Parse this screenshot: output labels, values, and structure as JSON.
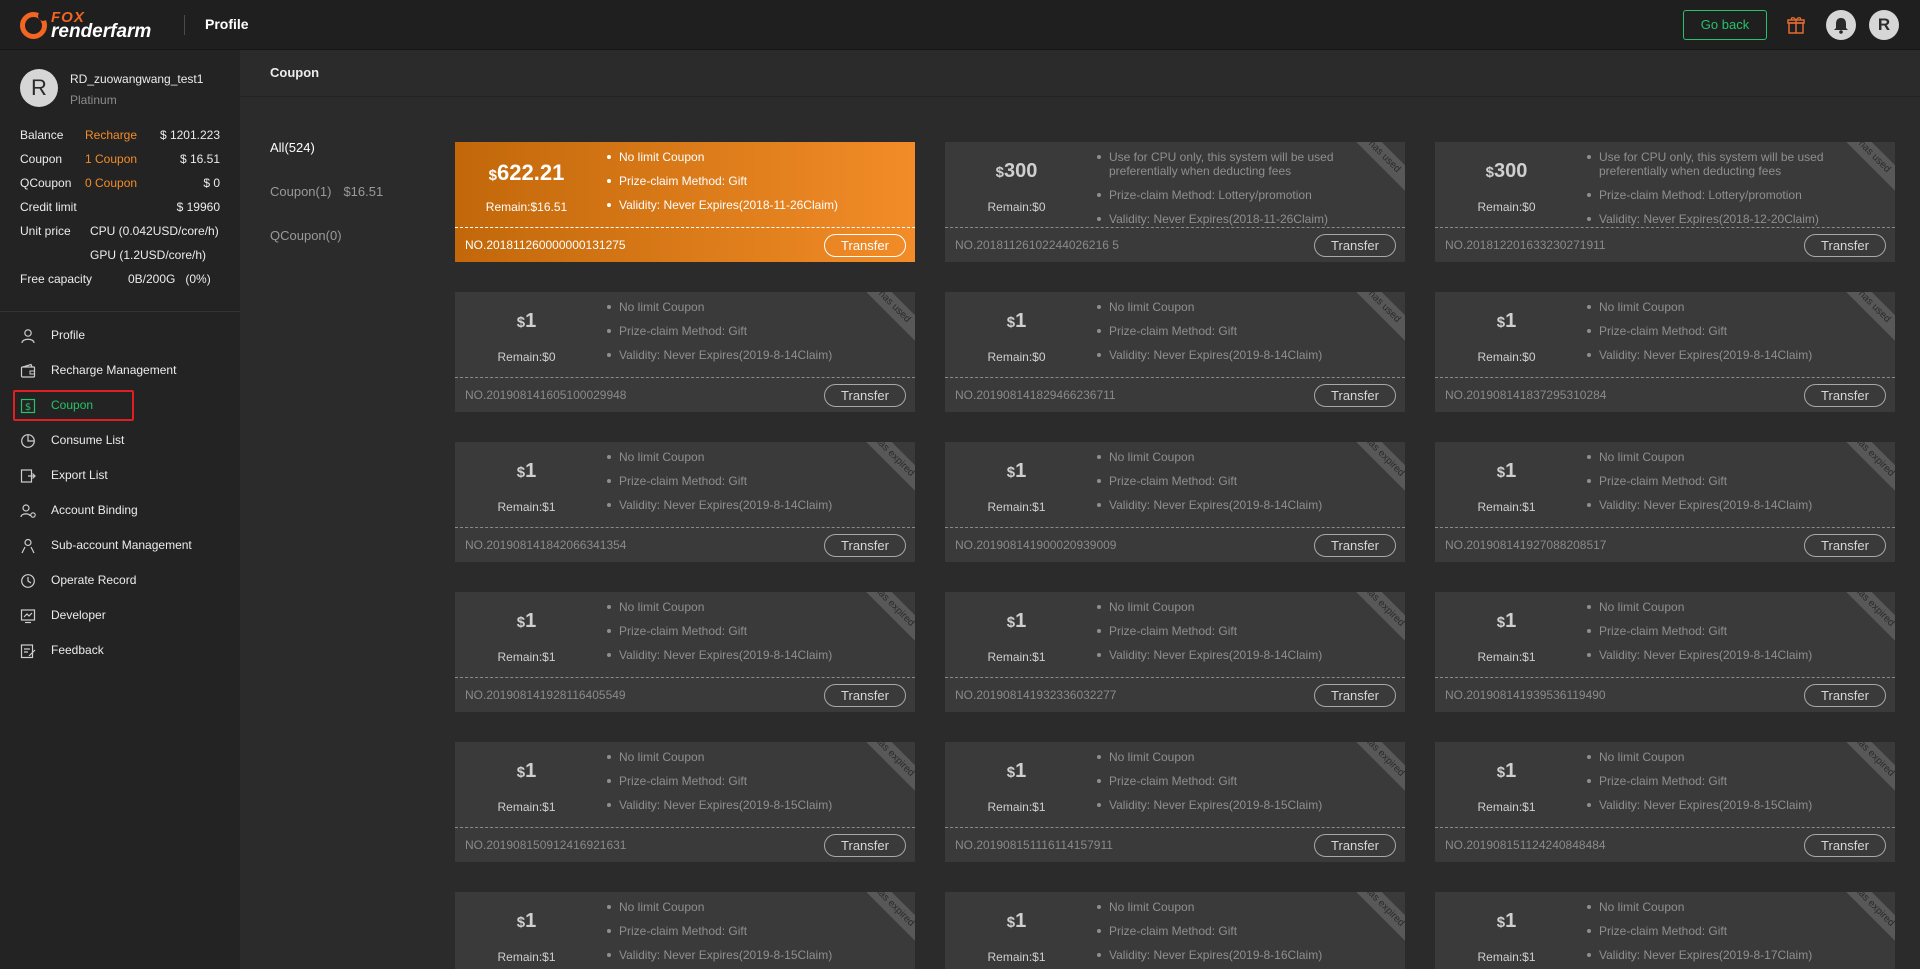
{
  "header": {
    "logo_fox": "FOX",
    "logo_rf": "renderfarm",
    "title": "Profile",
    "go_back": "Go back",
    "avatar_initial": "R"
  },
  "user": {
    "initial": "R",
    "name": "RD_zuowangwang_test1",
    "level": "Platinum"
  },
  "account": {
    "balance_label": "Balance",
    "recharge_link": "Recharge",
    "balance_value": "$ 1201.223",
    "coupon_label": "Coupon",
    "coupon_link": "1 Coupon",
    "coupon_value": "$ 16.51",
    "qcoupon_label": "QCoupon",
    "qcoupon_link": "0 Coupon",
    "qcoupon_value": "$ 0",
    "credit_label": "Credit limit",
    "credit_value": "$ 19960",
    "unit_label": "Unit price",
    "cpu_price": "CPU (0.042USD/core/h)",
    "gpu_price": "GPU (1.2USD/core/h)",
    "free_label": "Free capacity",
    "free_value": "0B/200G",
    "free_pct": "(0%)"
  },
  "nav": [
    {
      "label": "Profile",
      "icon": "user-icon"
    },
    {
      "label": "Recharge Management",
      "icon": "wallet-icon"
    },
    {
      "label": "Coupon",
      "icon": "coupon-icon",
      "active": true
    },
    {
      "label": "Consume List",
      "icon": "pie-chart-icon"
    },
    {
      "label": "Export List",
      "icon": "export-icon"
    },
    {
      "label": "Account Binding",
      "icon": "account-link-icon"
    },
    {
      "label": "Sub-account Management",
      "icon": "sub-account-icon"
    },
    {
      "label": "Operate Record",
      "icon": "clock-icon"
    },
    {
      "label": "Developer",
      "icon": "developer-icon"
    },
    {
      "label": "Feedback",
      "icon": "feedback-icon"
    }
  ],
  "main": {
    "title": "Coupon",
    "filters": [
      {
        "label": "All(524)",
        "amount": "",
        "active": true
      },
      {
        "label": "Coupon(1)",
        "amount": "$16.51",
        "active": false
      },
      {
        "label": "QCoupon(0)",
        "amount": "",
        "active": false
      }
    ]
  },
  "coupon_transfer_label": "Transfer",
  "coupons": [
    {
      "cur": "$",
      "amount": "622.21",
      "remain": "Remain:$16.51",
      "lines": [
        "No limit Coupon",
        "Prize-claim Method: Gift",
        "Validity: Never Expires(2018-11-26Claim)"
      ],
      "no": "NO.201811260000000131275",
      "ribbon": "",
      "primary": true
    },
    {
      "cur": "$",
      "amount": "300",
      "remain": "Remain:$0",
      "lines": [
        "Use for CPU only, this system will be used preferentially when deducting fees",
        "Prize-claim Method: Lottery/promotion",
        "Validity: Never Expires(2018-11-26Claim)"
      ],
      "no": "NO.20181126102244026216 5",
      "ribbon": "has used",
      "primary": false
    },
    {
      "cur": "$",
      "amount": "300",
      "remain": "Remain:$0",
      "lines": [
        "Use for CPU only, this system will be used preferentially when deducting fees",
        "Prize-claim Method: Lottery/promotion",
        "Validity: Never Expires(2018-12-20Claim)"
      ],
      "no": "NO.201812201633230271911",
      "ribbon": "has used",
      "primary": false
    },
    {
      "cur": "$",
      "amount": "1",
      "remain": "Remain:$0",
      "lines": [
        "No limit Coupon",
        "Prize-claim Method: Gift",
        "Validity: Never Expires(2019-8-14Claim)"
      ],
      "no": "NO.201908141605100029948",
      "ribbon": "has used",
      "primary": false
    },
    {
      "cur": "$",
      "amount": "1",
      "remain": "Remain:$0",
      "lines": [
        "No limit Coupon",
        "Prize-claim Method: Gift",
        "Validity: Never Expires(2019-8-14Claim)"
      ],
      "no": "NO.201908141829466236711",
      "ribbon": "has used",
      "primary": false
    },
    {
      "cur": "$",
      "amount": "1",
      "remain": "Remain:$0",
      "lines": [
        "No limit Coupon",
        "Prize-claim Method: Gift",
        "Validity: Never Expires(2019-8-14Claim)"
      ],
      "no": "NO.201908141837295310284",
      "ribbon": "has used",
      "primary": false
    },
    {
      "cur": "$",
      "amount": "1",
      "remain": "Remain:$1",
      "lines": [
        "No limit Coupon",
        "Prize-claim Method: Gift",
        "Validity: Never Expires(2019-8-14Claim)"
      ],
      "no": "NO.201908141842066341354",
      "ribbon": "has expired",
      "primary": false
    },
    {
      "cur": "$",
      "amount": "1",
      "remain": "Remain:$1",
      "lines": [
        "No limit Coupon",
        "Prize-claim Method: Gift",
        "Validity: Never Expires(2019-8-14Claim)"
      ],
      "no": "NO.201908141900020939009",
      "ribbon": "has expired",
      "primary": false
    },
    {
      "cur": "$",
      "amount": "1",
      "remain": "Remain:$1",
      "lines": [
        "No limit Coupon",
        "Prize-claim Method: Gift",
        "Validity: Never Expires(2019-8-14Claim)"
      ],
      "no": "NO.201908141927088208517",
      "ribbon": "has expired",
      "primary": false
    },
    {
      "cur": "$",
      "amount": "1",
      "remain": "Remain:$1",
      "lines": [
        "No limit Coupon",
        "Prize-claim Method: Gift",
        "Validity: Never Expires(2019-8-14Claim)"
      ],
      "no": "NO.201908141928116405549",
      "ribbon": "has expired",
      "primary": false
    },
    {
      "cur": "$",
      "amount": "1",
      "remain": "Remain:$1",
      "lines": [
        "No limit Coupon",
        "Prize-claim Method: Gift",
        "Validity: Never Expires(2019-8-14Claim)"
      ],
      "no": "NO.201908141932336032277",
      "ribbon": "has expired",
      "primary": false
    },
    {
      "cur": "$",
      "amount": "1",
      "remain": "Remain:$1",
      "lines": [
        "No limit Coupon",
        "Prize-claim Method: Gift",
        "Validity: Never Expires(2019-8-14Claim)"
      ],
      "no": "NO.201908141939536119490",
      "ribbon": "has expired",
      "primary": false
    },
    {
      "cur": "$",
      "amount": "1",
      "remain": "Remain:$1",
      "lines": [
        "No limit Coupon",
        "Prize-claim Method: Gift",
        "Validity: Never Expires(2019-8-15Claim)"
      ],
      "no": "NO.201908150912416921631",
      "ribbon": "has expired",
      "primary": false
    },
    {
      "cur": "$",
      "amount": "1",
      "remain": "Remain:$1",
      "lines": [
        "No limit Coupon",
        "Prize-claim Method: Gift",
        "Validity: Never Expires(2019-8-15Claim)"
      ],
      "no": "NO.201908151116114157911",
      "ribbon": "has expired",
      "primary": false
    },
    {
      "cur": "$",
      "amount": "1",
      "remain": "Remain:$1",
      "lines": [
        "No limit Coupon",
        "Prize-claim Method: Gift",
        "Validity: Never Expires(2019-8-15Claim)"
      ],
      "no": "NO.201908151124240848484",
      "ribbon": "has expired",
      "primary": false
    },
    {
      "cur": "$",
      "amount": "1",
      "remain": "Remain:$1",
      "lines": [
        "No limit Coupon",
        "Prize-claim Method: Gift",
        "Validity: Never Expires(2019-8-15Claim)"
      ],
      "no": "",
      "ribbon": "has expired",
      "primary": false
    },
    {
      "cur": "$",
      "amount": "1",
      "remain": "Remain:$1",
      "lines": [
        "No limit Coupon",
        "Prize-claim Method: Gift",
        "Validity: Never Expires(2019-8-16Claim)"
      ],
      "no": "",
      "ribbon": "has expired",
      "primary": false
    },
    {
      "cur": "$",
      "amount": "1",
      "remain": "Remain:$1",
      "lines": [
        "No limit Coupon",
        "Prize-claim Method: Gift",
        "Validity: Never Expires(2019-8-17Claim)"
      ],
      "no": "",
      "ribbon": "has expired",
      "primary": false
    }
  ],
  "colors": {
    "accent_green": "#27c26a",
    "accent_orange": "#f28c28",
    "highlight_red": "#e02020"
  }
}
